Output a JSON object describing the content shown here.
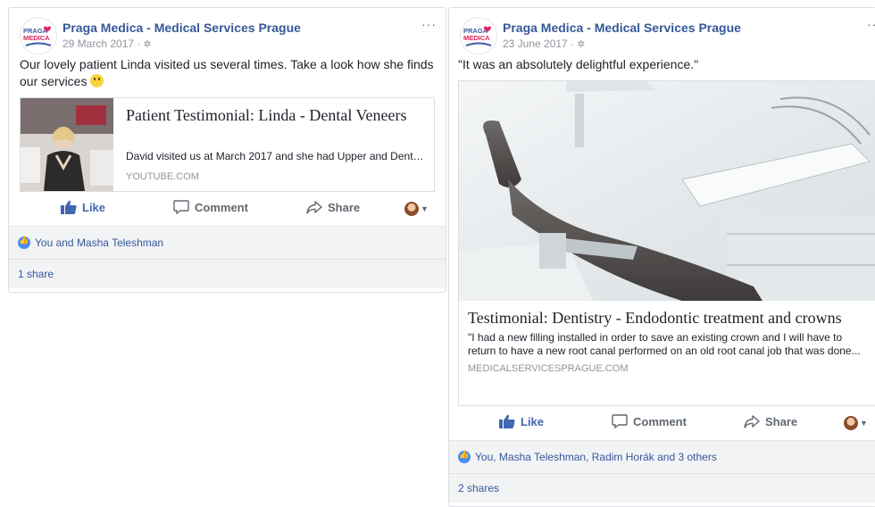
{
  "posts": [
    {
      "page_name": "Praga Medica - Medical Services Prague",
      "date": "29 March 2017 ·",
      "more": "···",
      "text": "Our lovely patient Linda visited us several times. Take a look how she finds our services",
      "card": {
        "title": "Patient Testimonial: Linda - Dental Veneers",
        "description": "David visited us at March 2017 and she had Upper and Dental...",
        "source": "YOUTUBE.COM"
      },
      "actions": {
        "like": "Like",
        "comment": "Comment",
        "share": "Share"
      },
      "reactions": "You and Masha Teleshman",
      "shares": "1 share"
    },
    {
      "page_name": "Praga Medica - Medical Services Prague",
      "date": "23 June 2017 ·",
      "more": "···",
      "text": "\"It was an absolutely delightful experience.\"",
      "card": {
        "title": "Testimonial: Dentistry - Endodontic treatment and crowns",
        "description": "\"I had a new filling installed in order to save an existing crown and I will have to return to have a new root canal performed on an old root canal job that was done...",
        "source": "MEDICALSERVICESPRAGUE.COM"
      },
      "actions": {
        "like": "Like",
        "comment": "Comment",
        "share": "Share"
      },
      "reactions": "You, Masha Teleshman, Radim Horák and 3 others",
      "shares": "2 shares"
    }
  ],
  "logo": {
    "line1": "PRAGA",
    "line2": "MEDICA"
  },
  "colors": {
    "link": "#365899",
    "like_blue": "#4267b2",
    "meta_gray": "#90949c"
  }
}
